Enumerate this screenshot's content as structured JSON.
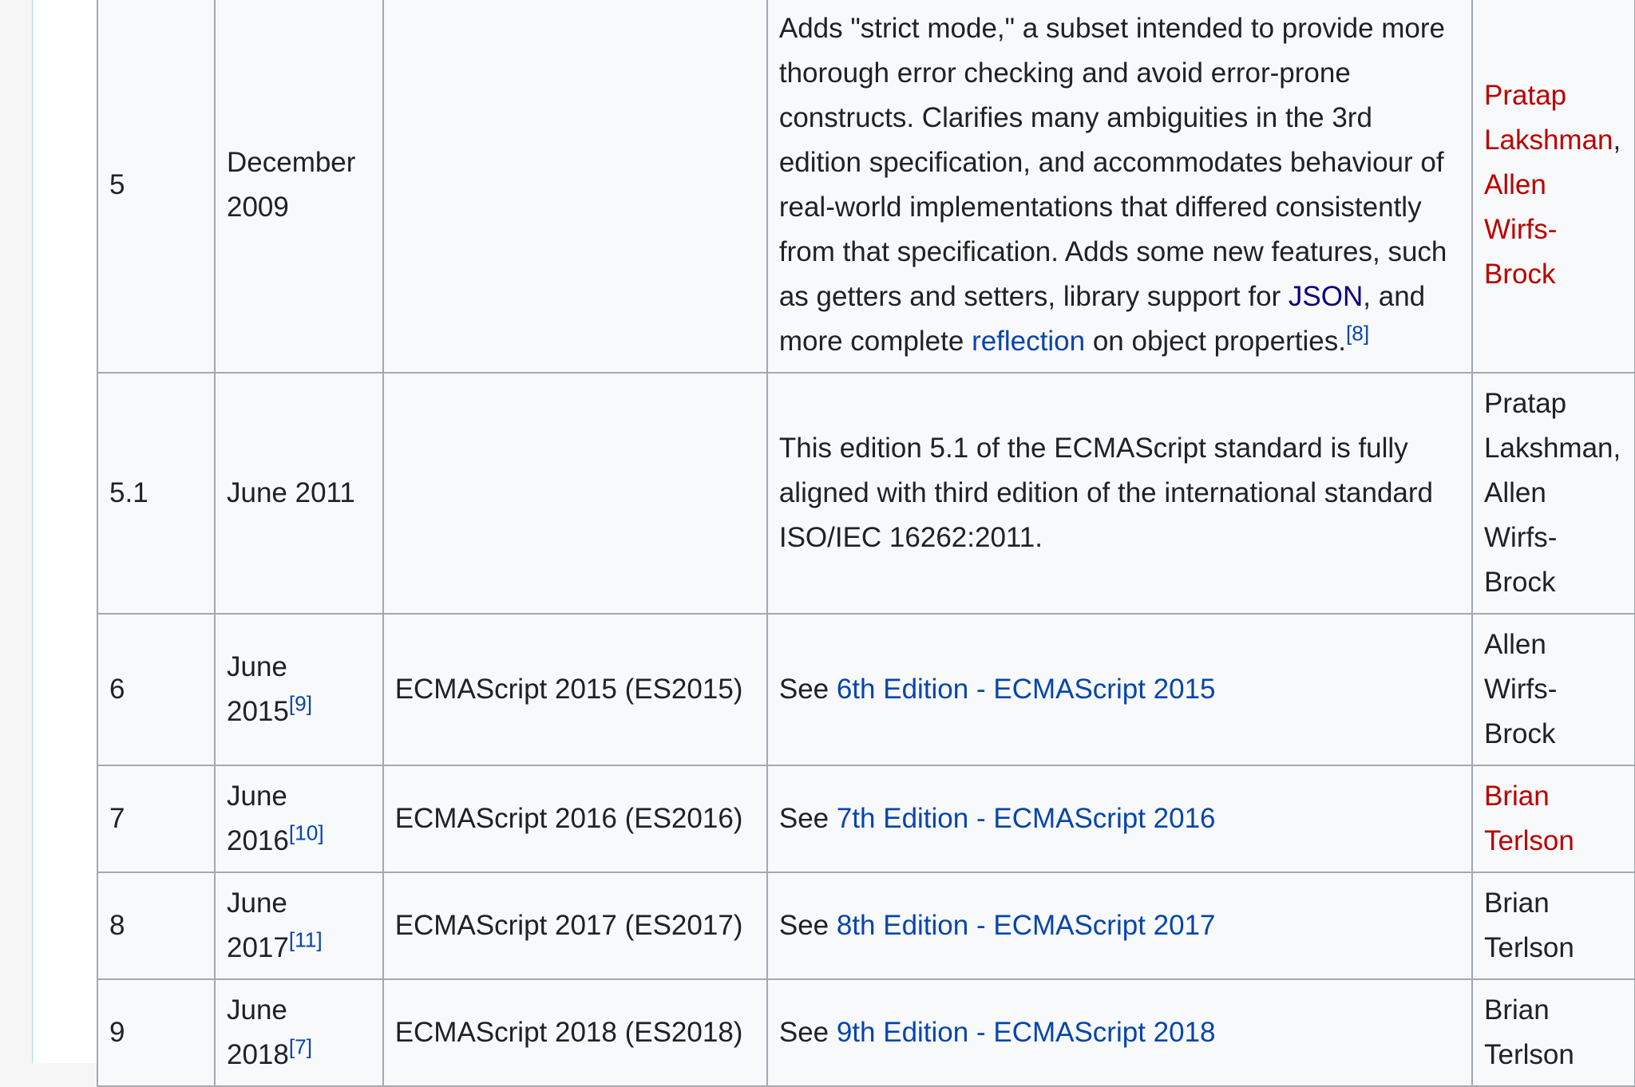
{
  "rows": [
    {
      "edition": "5",
      "date": "December 2009",
      "name": "",
      "desc_part1": "Adds \"strict mode,\" a subset intended to provide more thorough error checking and avoid error-prone constructs. Clarifies many ambiguities in the 3rd edition specification, and accommodates behaviour of real-world implementations that differed consistently from that specification. Adds some new features, such as getters and setters, library support for ",
      "desc_link1": "JSON",
      "desc_part2": ", and more complete ",
      "desc_link2": "reflection",
      "desc_part3": " on object properties.",
      "ref": "[8]",
      "editor1": "Pratap Lakshman",
      "editor_sep": ", ",
      "editor2": "Allen Wirfs-Brock"
    },
    {
      "edition": "5.1",
      "date": "June 2011",
      "name": "",
      "desc": "This edition 5.1 of the ECMAScript standard is fully aligned with third edition of the international standard ISO/IEC 16262:2011.",
      "editor": "Pratap Lakshman, Allen Wirfs-Brock"
    },
    {
      "edition": "6",
      "date": "June 2015",
      "date_ref": "[9]",
      "name": "ECMAScript 2015 (ES2015)",
      "desc_prefix": "See ",
      "desc_link": "6th Edition - ECMAScript 2015",
      "editor": "Allen Wirfs-Brock"
    },
    {
      "edition": "7",
      "date": "June 2016",
      "date_ref": "[10]",
      "name": "ECMAScript 2016 (ES2016)",
      "desc_prefix": "See ",
      "desc_link": "7th Edition - ECMAScript 2016",
      "editor": "Brian Terlson"
    },
    {
      "edition": "8",
      "date": "June 2017",
      "date_ref": "[11]",
      "name": "ECMAScript 2017 (ES2017)",
      "desc_prefix": "See ",
      "desc_link": "8th Edition - ECMAScript 2017",
      "editor": "Brian Terlson"
    },
    {
      "edition": "9",
      "date": "June 2018",
      "date_ref": "[7]",
      "name": "ECMAScript 2018 (ES2018)",
      "desc_prefix": "See ",
      "desc_link": "9th Edition - ECMAScript 2018",
      "editor": "Brian Terlson"
    }
  ],
  "colors": {
    "link": "#0645ad",
    "link_visited": "#0b0080",
    "link_new": "#ba0000",
    "border": "#a2a9b1",
    "cell_bg": "#f8f9fa"
  }
}
